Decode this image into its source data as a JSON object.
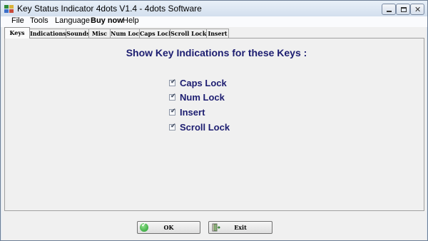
{
  "window": {
    "title": "Key Status Indicator 4dots V1.4 - 4dots Software"
  },
  "menu": {
    "items": [
      "File",
      "Tools",
      "Language",
      "Buy now",
      "Help"
    ]
  },
  "tabs": [
    "Keys",
    "Indications",
    "Sounds",
    "Misc",
    "Num Lock",
    "Caps Lock",
    "Scroll Lock",
    "Insert"
  ],
  "active_tab": "Keys",
  "panel": {
    "heading": "Show Key Indications for these Keys :",
    "options": [
      {
        "label": "Caps Lock",
        "checked": true
      },
      {
        "label": "Num Lock",
        "checked": true
      },
      {
        "label": "Insert",
        "checked": true
      },
      {
        "label": "Scroll Lock",
        "checked": true
      }
    ]
  },
  "buttons": {
    "ok": "OK",
    "exit": "Exit"
  },
  "icons": {
    "app": "key-app-icon",
    "ok": "green-check-icon",
    "exit": "exit-door-icon"
  },
  "colors": {
    "accent_text": "#1c1d70",
    "ok_icon": "#1f9a2a"
  }
}
